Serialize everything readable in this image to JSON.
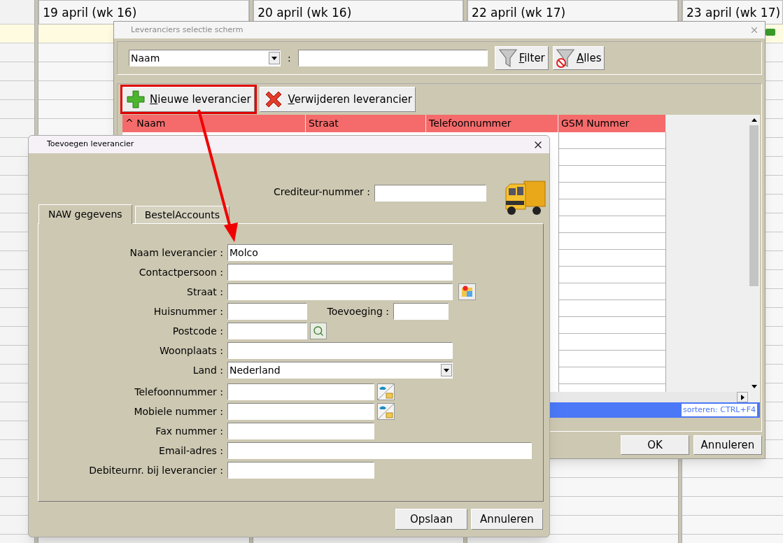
{
  "calendar": {
    "columns": [
      {
        "header": "19 april (wk 16)"
      },
      {
        "header": "20 april (wk 16)"
      },
      {
        "header": "22 april (wk 17)"
      },
      {
        "header": "23 april (wk 17)"
      }
    ]
  },
  "supplier_window": {
    "title": "Leveranciers selectie scherm",
    "filter": {
      "field": "Naam",
      "separator": ":",
      "buttons": [
        {
          "label": "Filter"
        },
        {
          "label": "Alles"
        }
      ]
    },
    "toolbar": [
      {
        "label": "Nieuwe leverancier",
        "highlighted": true
      },
      {
        "label": "Verwijderen leverancier",
        "highlighted": false
      }
    ],
    "table": {
      "columns": [
        "^ Naam",
        "Straat",
        "Telefoonnummer",
        "GSM Nummer"
      ]
    },
    "status_bar": "sorteren: CTRL+F4",
    "buttons": [
      "OK",
      "Annuleren"
    ]
  },
  "add_dialog": {
    "title": "Toevoegen leverancier",
    "creditor": {
      "label": "Crediteur-nummer :"
    },
    "tabs": [
      {
        "label": "NAW gegevens",
        "selected": true
      },
      {
        "label": "BestelAccounts",
        "selected": false
      }
    ],
    "fields": [
      {
        "kind": "text",
        "label": "Naam leverancier :",
        "value": "Molco"
      },
      {
        "kind": "text",
        "label": "Contactpersoon :"
      },
      {
        "kind": "text",
        "label": "Straat :"
      },
      {
        "kind": "text",
        "label": "Huisnummer :",
        "extra_label": "Toevoeging :"
      },
      {
        "kind": "text",
        "label": "Postcode :"
      },
      {
        "kind": "text",
        "label": "Woonplaats :"
      },
      {
        "kind": "select",
        "label": "Land :",
        "value": "Nederland"
      },
      {
        "kind": "text",
        "label": "Telefoonnummer :"
      },
      {
        "kind": "text",
        "label": "Mobiele nummer :"
      },
      {
        "kind": "text",
        "label": "Fax nummer :"
      },
      {
        "kind": "text",
        "label": "Email-adres :"
      },
      {
        "kind": "text",
        "label": "Debiteurnr. bij leverancier :"
      }
    ],
    "buttons": [
      "Opslaan",
      "Annuleren"
    ]
  }
}
